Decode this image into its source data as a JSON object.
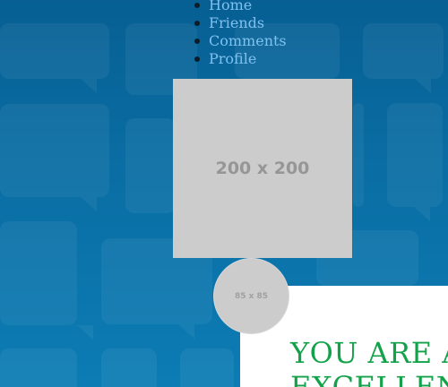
{
  "nav": {
    "items": [
      {
        "label": "Home"
      },
      {
        "label": "Friends"
      },
      {
        "label": "Comments"
      },
      {
        "label": "Profile"
      }
    ]
  },
  "images": {
    "large_placeholder": "200 x 200",
    "avatar_placeholder": "85 x 85"
  },
  "panel": {
    "heading": "YOU ARE A\nEXCELLENT"
  },
  "colors": {
    "background": "#0a6ea4",
    "nav_link": "#7fc1ef",
    "placeholder": "#cccccc",
    "heading": "#13a24a"
  }
}
